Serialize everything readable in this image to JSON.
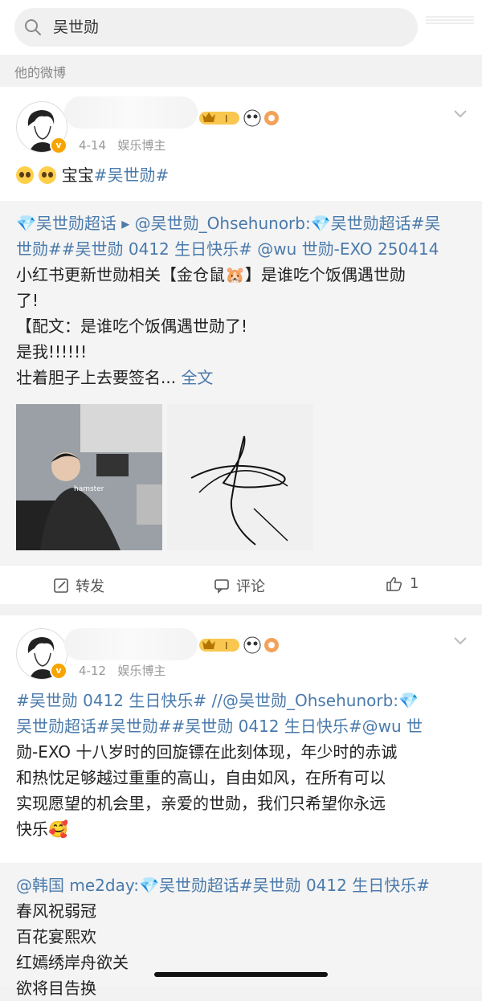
{
  "search": {
    "query": "吴世勋"
  },
  "section": {
    "label": "他的微博"
  },
  "posts": [
    {
      "date": "4-14",
      "role": "娱乐博主",
      "badge_level": "I",
      "text_plain": "宝宝",
      "text_tag": "#吴世勋#",
      "repost": {
        "lines": [
          "💎吴世勋超话 ▸ @吴世勋_Ohsehunorb:💎吴世勋超话#吴",
          "世勋##吴世勋 0412 生日快乐# @wu 世勋-EXO  250414",
          "小红书更新世勋相关【金仓鼠🐹】是谁吃个饭偶遇世勋",
          "了!",
          "【配文：是谁吃个饭偶遇世勋了!",
          "是我!!!!!!",
          "壮着胆子上去要签名... "
        ],
        "more": "全文",
        "photo_caption": "hamster"
      },
      "actions": {
        "repost": "转发",
        "comment": "评论",
        "like_count": "1"
      }
    },
    {
      "date": "4-12",
      "role": "娱乐博主",
      "badge_level": "I",
      "lines": [
        "#吴世勋 0412 生日快乐# //@吴世勋_Ohsehunorb:💎",
        "吴世勋超话#吴世勋##吴世勋 0412 生日快乐#@wu 世",
        "勋-EXO 十八岁时的回旋镖在此刻体现，年少时的赤诚",
        "和热忱足够越过重重的高山，自由如风，在所有可以",
        "实现愿望的机会里，亲爱的世勋，我们只希望你永远",
        "快乐🥰"
      ],
      "repost": {
        "lines": [
          "@韩国 me2day:💎吴世勋超话#吴世勋 0412 生日快乐#",
          "春风祝弱冠",
          "百花宴熙欢",
          "红嫣绣岸舟欲关",
          "欲将目告换"
        ]
      }
    }
  ],
  "colors": {
    "link": "#4a7aab",
    "accent_gold": "#f7a400"
  }
}
